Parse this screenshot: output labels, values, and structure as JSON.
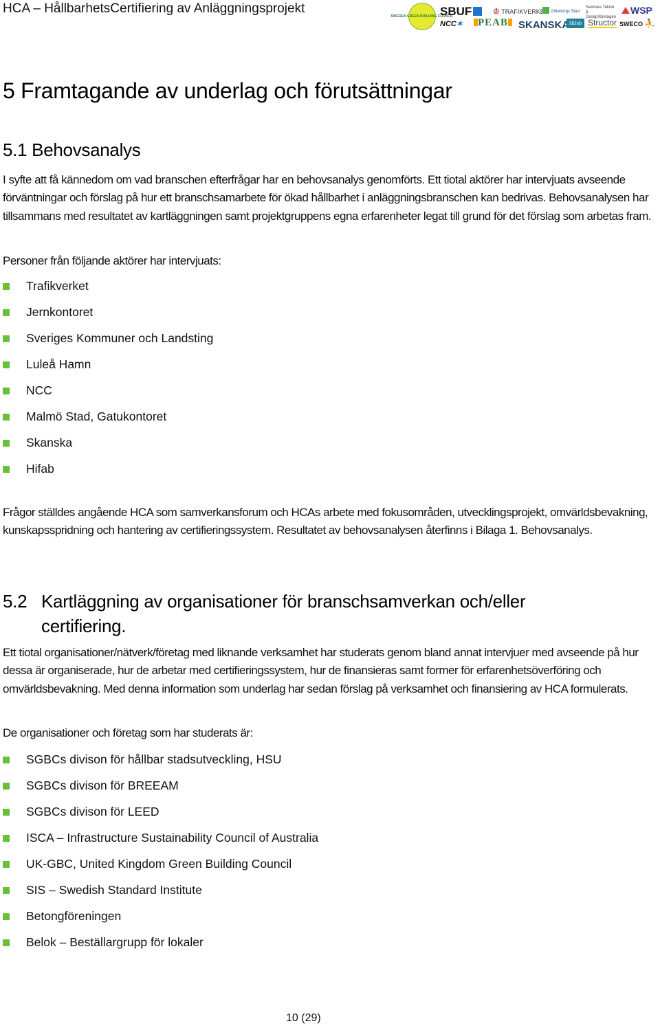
{
  "header": {
    "title": "HCA – HållbarhetsCertifiering av Anläggningsprojekt",
    "logos": [
      {
        "name": "Sweden Green Building Council",
        "text": "SWEDEN GREEN BUILDING COUNCIL"
      },
      {
        "name": "SBUF",
        "text": "SBUF"
      },
      {
        "name": "Trafikverket",
        "text": "TRAFIKVERKET"
      },
      {
        "name": "Göteborgs Stad",
        "text": "Göteborgs Stad"
      },
      {
        "name": "Svenska Teknik & Designföretagen",
        "text": "Svenska Teknik & Designföretagen"
      },
      {
        "name": "WSP",
        "text": "WSP"
      },
      {
        "name": "NCC",
        "text": "NCC"
      },
      {
        "name": "PEAB",
        "text": "PEAB"
      },
      {
        "name": "Skanska",
        "text": "SKANSKA"
      },
      {
        "name": "Hifab",
        "text": "Hifab"
      },
      {
        "name": "Structor",
        "text": "Structor"
      },
      {
        "name": "Sweco",
        "text": "SWECO"
      }
    ]
  },
  "section5": {
    "heading": "5  Framtagande av underlag och förutsättningar",
    "sub1": {
      "heading": "5.1  Behovsanalys",
      "paragraph1": "I syfte att få kännedom om vad branschen efterfrågar har en behovsanalys genomförts. Ett tiotal aktörer har intervjuats avseende förväntningar och förslag på hur ett branschsamarbete för ökad hållbarhet i anläggningsbranschen kan bedrivas. Behovsanalysen har tillsammans med resultatet av kartläggningen samt projektgruppens egna erfarenheter legat till grund för det förslag som arbetas fram.",
      "list_intro": "Personer från följande aktörer har intervjuats:",
      "interviewed": [
        "Trafikverket",
        "Jernkontoret",
        "Sveriges Kommuner och Landsting",
        "Luleå Hamn",
        "NCC",
        "Malmö Stad, Gatukontoret",
        "Skanska",
        "Hifab"
      ],
      "paragraph2": "Frågor ställdes angående HCA som samverkansforum och HCAs arbete med fokusområden, utvecklingsprojekt, omvärldsbevakning, kunskapsspridning och hantering av certifieringssystem. Resultatet av behovsanalysen återfinns i Bilaga 1. Behovsanalys."
    },
    "sub2": {
      "heading_num": "5.2",
      "heading_line1": "Kartläggning av organisationer för branschsamverkan och/eller",
      "heading_line2": "certifiering.",
      "paragraph1": "Ett tiotal organisationer/nätverk/företag med liknande verksamhet har studerats genom bland annat intervjuer med avseende på hur dessa är organiserade, hur de arbetar med certifieringssystem, hur de finansieras samt former för erfarenhetsöverföring och omvärldsbevakning. Med denna information som underlag har sedan förslag på verksamhet och finansiering av HCA formulerats.",
      "list_intro": "De organisationer och företag som har studerats är:",
      "studied": [
        "SGBCs divison för hållbar stadsutveckling, HSU",
        "SGBCs divison för BREEAM",
        "SGBCs divison för LEED",
        "ISCA – Infrastructure Sustainability Council of Australia",
        "UK-GBC, United Kingdom Green Building Council",
        "SIS – Swedish Standard Institute",
        "Betongföreningen",
        "Belok – Beställargrupp för lokaler"
      ]
    }
  },
  "footer": {
    "page_number": "10 (29)"
  },
  "colors": {
    "bullet": "#6abf3b",
    "text": "#111111"
  }
}
